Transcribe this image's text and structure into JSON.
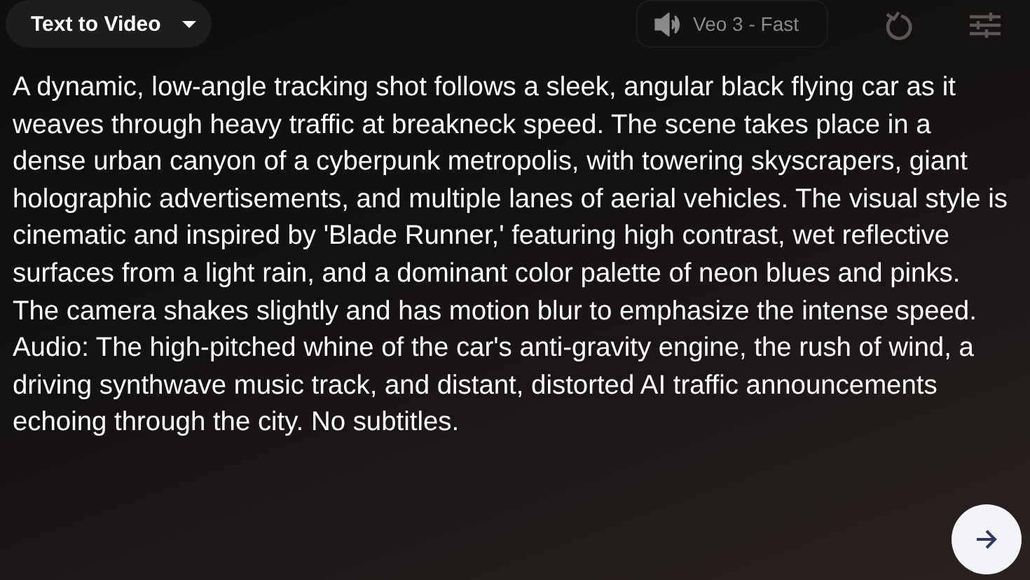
{
  "mode_menu": {
    "label": "Text to Video"
  },
  "model": {
    "label": "Veo 3 - Fast"
  },
  "prompt": {
    "value": "A dynamic, low-angle tracking shot follows a sleek, angular black flying car as it weaves through heavy traffic at breakneck speed. The scene takes place in a dense urban canyon of a cyberpunk metropolis, with towering skyscrapers, giant holographic advertisements, and multiple lanes of aerial vehicles. The visual style is cinematic and inspired by 'Blade Runner,' featuring high contrast, wet reflective surfaces from a light rain, and a dominant color palette of neon blues and pinks. The camera shakes slightly and has motion blur to emphasize the intense speed. Audio: The high-pitched whine of the car's anti-gravity engine, the rush of wind, a driving synthwave music track, and distant, distorted AI traffic announcements echoing through the city. No subtitles."
  }
}
